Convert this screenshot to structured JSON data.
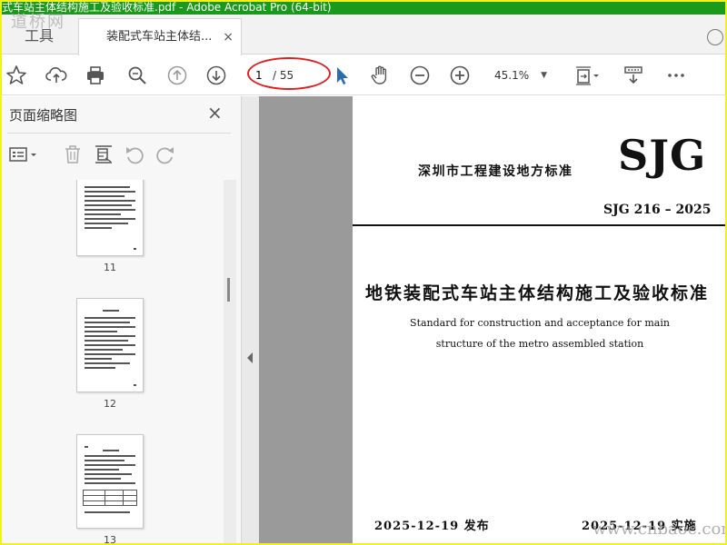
{
  "window": {
    "title": "式车站主体结构施工及验收标准.pdf - Adobe Acrobat Pro (64-bit)",
    "watermark_top": "道桥网",
    "watermark_bottom": "www.cnbaoc.com"
  },
  "tabs": {
    "tools_label": "工具",
    "doc_label": "装配式车站主体结...",
    "close_glyph": "×"
  },
  "toolbar": {
    "icons": [
      "star-icon",
      "upload-cloud-icon",
      "print-icon",
      "zoom-search-icon",
      "page-up-icon",
      "page-down-icon",
      "select-arrow-icon",
      "hand-icon",
      "zoom-out-icon",
      "zoom-in-icon",
      "fit-page-icon",
      "scroll-mode-icon",
      "more-icon"
    ],
    "current_page": "1",
    "total_pages": "/ 55",
    "zoom": "45.1%",
    "highlight_color": "#e02020",
    "accent_color": "#2b6cb0"
  },
  "sidebar": {
    "title": "页面缩略图",
    "close_glyph": "×",
    "thumbnails": [
      {
        "label": "11"
      },
      {
        "label": "12"
      },
      {
        "label": "13"
      }
    ]
  },
  "document": {
    "standard_cn": "深圳市工程建设地方标准",
    "logo": "SJG",
    "code": "SJG 216 – 2025",
    "title_cn": "地铁装配式车站主体结构施工及验收标准",
    "title_en_line1": "Standard for construction and acceptance for main",
    "title_en_line2": "structure of the metro assembled station",
    "issue_date": "2025-12-19  发布",
    "impl_date": "2025-12-19  实施"
  }
}
